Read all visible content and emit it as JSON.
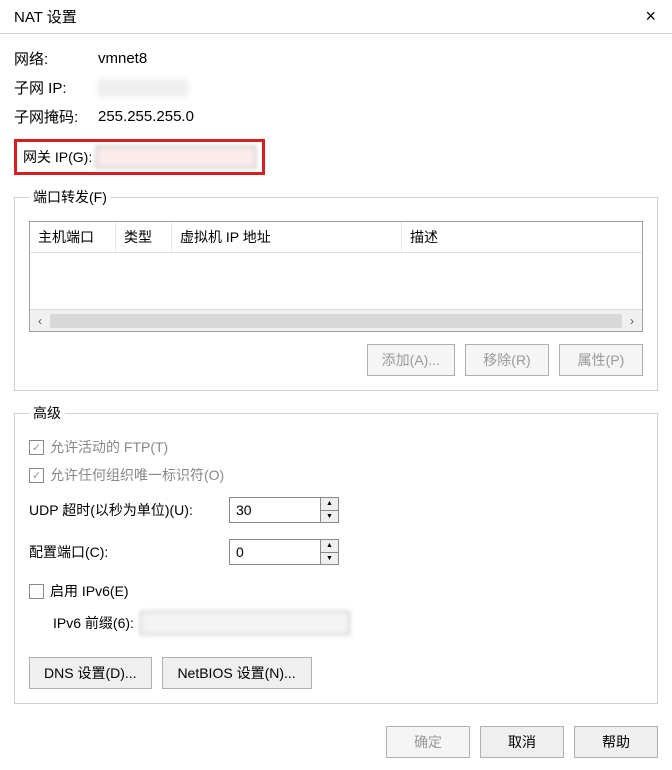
{
  "title": "NAT 设置",
  "close_icon": "×",
  "info": {
    "network_label": "网络:",
    "network_value": "vmnet8",
    "subnet_ip_label": "子网 IP:",
    "subnet_mask_label": "子网掩码:",
    "subnet_mask_value": "255.255.255.0",
    "gateway_label": "网关 IP(G):"
  },
  "port_forward": {
    "legend": "端口转发(F)",
    "headers": {
      "host_port": "主机端口",
      "type": "类型",
      "vm_ip": "虚拟机 IP 地址",
      "desc": "描述"
    },
    "scroll_left": "‹",
    "scroll_right": "›",
    "add_btn": "添加(A)...",
    "remove_btn": "移除(R)",
    "props_btn": "属性(P)"
  },
  "advanced": {
    "legend": "高级",
    "ftp_label": "允许活动的 FTP(T)",
    "oui_label": "允许任何组织唯一标识符(O)",
    "udp_timeout_label": "UDP 超时(以秒为单位)(U):",
    "udp_timeout_value": "30",
    "config_port_label": "配置端口(C):",
    "config_port_value": "0",
    "ipv6_enable_label": "启用 IPv6(E)",
    "ipv6_prefix_label": "IPv6 前缀(6):",
    "dns_btn": "DNS 设置(D)...",
    "netbios_btn": "NetBIOS 设置(N)..."
  },
  "dialog": {
    "ok_btn": "确定",
    "cancel_btn": "取消",
    "help_btn": "帮助"
  }
}
